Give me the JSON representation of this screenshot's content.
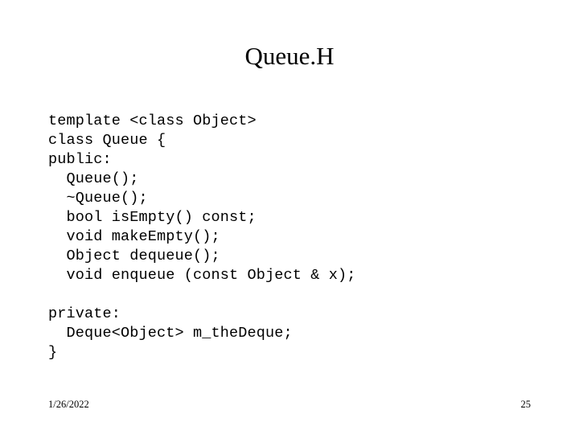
{
  "slide": {
    "title": "Queue.H",
    "background_color": "#ffffff",
    "text_color": "#000000"
  },
  "code": {
    "lines": [
      "template <class Object>",
      "class Queue {",
      "public:",
      "  Queue();",
      "  ~Queue();",
      "  bool isEmpty() const;",
      "  void makeEmpty();",
      "  Object dequeue();",
      "  void enqueue (const Object & x);",
      "",
      "private:",
      "  Deque<Object> m_theDeque;",
      "}"
    ]
  },
  "footer": {
    "date": "1/26/2022",
    "page_number": "25"
  }
}
